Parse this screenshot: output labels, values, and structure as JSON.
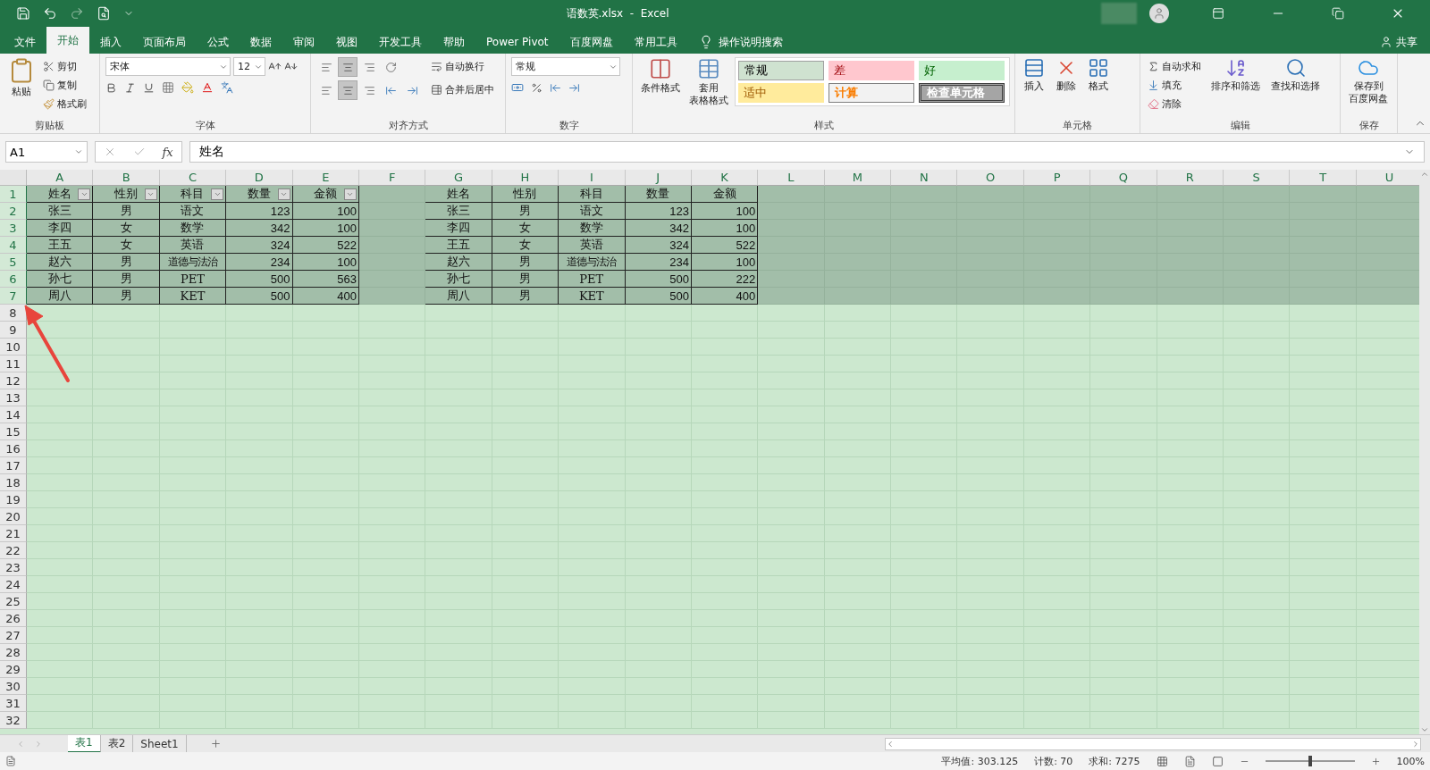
{
  "title_bar": {
    "title": "语数英.xlsx  -  Excel"
  },
  "menu_tabs": [
    {
      "label": "文件",
      "selected": false
    },
    {
      "label": "开始",
      "selected": true
    },
    {
      "label": "插入",
      "selected": false
    },
    {
      "label": "页面布局",
      "selected": false
    },
    {
      "label": "公式",
      "selected": false
    },
    {
      "label": "数据",
      "selected": false
    },
    {
      "label": "审阅",
      "selected": false
    },
    {
      "label": "视图",
      "selected": false
    },
    {
      "label": "开发工具",
      "selected": false
    },
    {
      "label": "帮助",
      "selected": false
    },
    {
      "label": "Power Pivot",
      "selected": false
    },
    {
      "label": "百度网盘",
      "selected": false
    },
    {
      "label": "常用工具",
      "selected": false
    }
  ],
  "tell_me": "操作说明搜索",
  "share": "共享",
  "ribbon": {
    "clipboard": {
      "label": "剪贴板",
      "paste": "粘贴",
      "cut": "剪切",
      "copy": "复制",
      "format_painter": "格式刷"
    },
    "font": {
      "label": "字体",
      "font_name": "宋体",
      "font_size": "12"
    },
    "alignment": {
      "label": "对齐方式",
      "wrap": "自动换行",
      "merge": "合并后居中"
    },
    "number": {
      "label": "数字",
      "format": "常规"
    },
    "styles": {
      "label": "样式",
      "conditional": [
        "条件格式"
      ],
      "table_format": [
        "套用",
        "表格格式"
      ],
      "cell_styles": [
        {
          "label": "常规",
          "kind": "normal"
        },
        {
          "label": "差",
          "kind": "bad"
        },
        {
          "label": "好",
          "kind": "good"
        },
        {
          "label": "适中",
          "kind": "neutral"
        },
        {
          "label": "计算",
          "kind": "calculation"
        },
        {
          "label": "检查单元格",
          "kind": "check"
        }
      ]
    },
    "cells": {
      "label": "单元格",
      "insert": "插入",
      "delete": "删除",
      "format": "格式"
    },
    "editing": {
      "label": "编辑",
      "autosum": "自动求和",
      "fill": "填充",
      "clear": "清除",
      "sort": "排序和筛选",
      "find": "查找和选择"
    },
    "save": {
      "label": "保存",
      "button": [
        "保存到",
        "百度网盘"
      ]
    }
  },
  "formula_bar": {
    "name_box": "A1",
    "fx": "fx",
    "value": "姓名"
  },
  "sheet": {
    "columns": [
      "A",
      "B",
      "C",
      "D",
      "E",
      "F",
      "G",
      "H",
      "I",
      "J",
      "K",
      "L",
      "M",
      "N",
      "O",
      "P",
      "Q",
      "R",
      "S",
      "T",
      "U"
    ],
    "rows": [
      {
        "label": "1",
        "selected": true
      },
      {
        "label": "2",
        "selected": true
      },
      {
        "label": "3",
        "selected": true
      },
      {
        "label": "4",
        "selected": true
      },
      {
        "label": "5",
        "selected": true
      },
      {
        "label": "6",
        "selected": true
      },
      {
        "label": "7",
        "selected": true
      },
      {
        "label": "8",
        "selected": false
      },
      {
        "label": "9",
        "selected": false
      },
      {
        "label": "10",
        "selected": false
      },
      {
        "label": "11",
        "selected": false
      },
      {
        "label": "12",
        "selected": false
      },
      {
        "label": "13",
        "selected": false
      },
      {
        "label": "14",
        "selected": false
      },
      {
        "label": "15",
        "selected": false
      },
      {
        "label": "16",
        "selected": false
      },
      {
        "label": "17",
        "selected": false
      },
      {
        "label": "18",
        "selected": false
      },
      {
        "label": "19",
        "selected": false
      },
      {
        "label": "20",
        "selected": false
      },
      {
        "label": "21",
        "selected": false
      },
      {
        "label": "22",
        "selected": false
      },
      {
        "label": "23",
        "selected": false
      },
      {
        "label": "24",
        "selected": false
      },
      {
        "label": "25",
        "selected": false
      },
      {
        "label": "26",
        "selected": false
      },
      {
        "label": "27",
        "selected": false
      },
      {
        "label": "28",
        "selected": false
      },
      {
        "label": "29",
        "selected": false
      },
      {
        "label": "30",
        "selected": false
      },
      {
        "label": "31",
        "selected": false
      },
      {
        "label": "32",
        "selected": false
      }
    ],
    "tables": [
      {
        "filter_buttons": true,
        "columns": [
          {
            "label": "姓名"
          },
          {
            "label": "性别"
          },
          {
            "label": "科目"
          },
          {
            "label": "数量"
          },
          {
            "label": "金额"
          }
        ],
        "rows": [
          [
            "张三",
            "男",
            "语文",
            "123",
            "100"
          ],
          [
            "李四",
            "女",
            "数学",
            "342",
            "100"
          ],
          [
            "王五",
            "女",
            "英语",
            "324",
            "522"
          ],
          [
            "赵六",
            "男",
            "道德与法治",
            "234",
            "100"
          ],
          [
            "孙七",
            "男",
            "PET",
            "500",
            "563"
          ],
          [
            "周八",
            "男",
            "KET",
            "500",
            "400"
          ]
        ]
      },
      {
        "filter_buttons": false,
        "columns": [
          {
            "label": "姓名"
          },
          {
            "label": "性别"
          },
          {
            "label": "科目"
          },
          {
            "label": "数量"
          },
          {
            "label": "金额"
          }
        ],
        "rows": [
          [
            "张三",
            "男",
            "语文",
            "123",
            "100"
          ],
          [
            "李四",
            "女",
            "数学",
            "342",
            "100"
          ],
          [
            "王五",
            "女",
            "英语",
            "324",
            "522"
          ],
          [
            "赵六",
            "男",
            "道德与法治",
            "234",
            "100"
          ],
          [
            "孙七",
            "男",
            "PET",
            "500",
            "222"
          ],
          [
            "周八",
            "男",
            "KET",
            "500",
            "400"
          ]
        ]
      }
    ]
  },
  "sheet_tabs": [
    {
      "label": "表1",
      "selected": true
    },
    {
      "label": "表2",
      "selected": false
    },
    {
      "label": "Sheet1",
      "selected": false
    }
  ],
  "status_bar": {
    "average": "平均值: 303.125",
    "count": "计数: 70",
    "sum": "求和: 7275",
    "zoom": "100%",
    "zoom_level": {
      "level": 0.5
    }
  }
}
